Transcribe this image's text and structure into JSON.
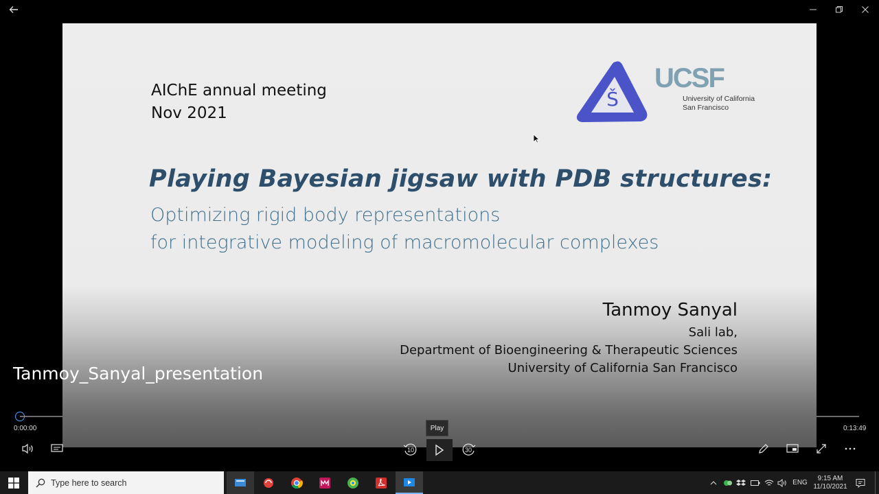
{
  "slide": {
    "meeting_line1": "AIChE annual meeting",
    "meeting_line2": "Nov 2021",
    "title": "Playing Bayesian jigsaw with PDB structures:",
    "subtitle_line1": "Optimizing rigid body representations",
    "subtitle_line2": "for integrative modeling of macromolecular complexes",
    "author": "Tanmoy Sanyal",
    "affiliation_line1": "Sali lab,",
    "affiliation_line2": "Department of Bioengineering & Therapeutic Sciences",
    "affiliation_line3": "University of California San Francisco",
    "ucsf_logo_text": "UCSF",
    "ucsf_sub_line1": "University of California",
    "ucsf_sub_line2": "San Francisco",
    "lab_logo_letter": "Š"
  },
  "player": {
    "video_title": "Tanmoy_Sanyal_presentation",
    "current_time": "0:00:00",
    "total_time": "0:13:49",
    "tooltip": "Play",
    "rewind_label": "10",
    "forward_label": "30",
    "progress": 0
  },
  "taskbar": {
    "search_placeholder": "Type here to search",
    "language": "ENG",
    "clock_time": "9:15 AM",
    "clock_date": "11/10/2021"
  },
  "colors": {
    "accent": "#4aa3ff",
    "title_blue": "#2e4f6c",
    "subtitle_blue": "#3f6f8c",
    "ucsf_blue": "#7fa1b2",
    "lab_logo_blue": "#4a54c8"
  }
}
